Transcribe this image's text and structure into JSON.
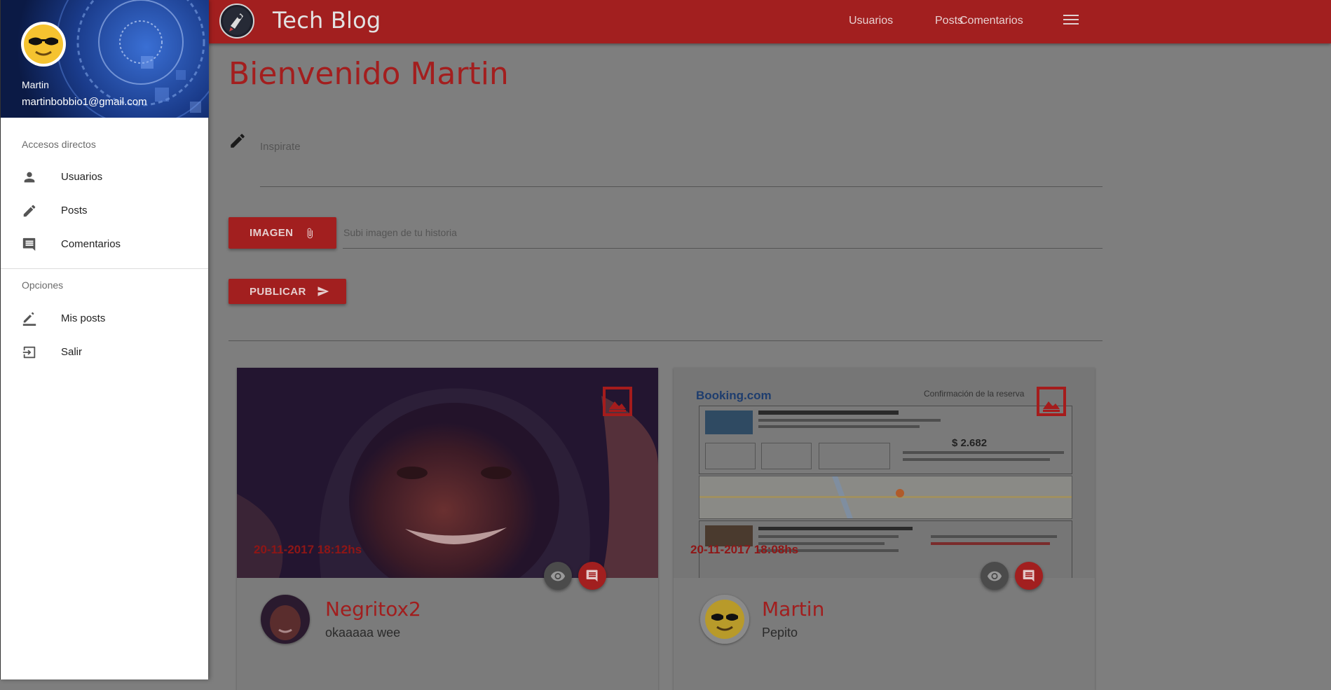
{
  "app": {
    "title": "Tech Blog"
  },
  "topnav": {
    "items": [
      "Usuarios",
      "Posts",
      "Comentarios"
    ],
    "menu_icon": "hamburger-menu-icon"
  },
  "drawer": {
    "user_name": "Martin",
    "user_email": "martinbobbio1@gmail.com",
    "sections": [
      {
        "title": "Accesos directos",
        "items": [
          {
            "label": "Usuarios",
            "icon": "person-icon"
          },
          {
            "label": "Posts",
            "icon": "pencil-icon"
          },
          {
            "label": "Comentarios",
            "icon": "comment-icon"
          }
        ]
      },
      {
        "title": "Opciones",
        "items": [
          {
            "label": "Mis posts",
            "icon": "edit-underline-icon"
          },
          {
            "label": "Salir",
            "icon": "exit-icon"
          }
        ]
      }
    ]
  },
  "main": {
    "welcome": "Bienvenido Martin",
    "story_placeholder": "Inspirate",
    "image_button": "IMAGEN",
    "image_placeholder": "Subi imagen de tu historia",
    "publish_button": "PUBLICAR"
  },
  "posts": [
    {
      "date": "20-11-2017 18:12hs",
      "author": "Negritox2",
      "text": "okaaaaa wee"
    },
    {
      "date": "20-11-2017 18:08hs",
      "author": "Martin",
      "text": "Pepito",
      "image_brand": "Booking.com",
      "image_heading": "Confirmación de la reserva",
      "image_price": "$ 2.682"
    }
  ],
  "colors": {
    "primary": "#a21f1f",
    "drawer_bg": "#ffffff",
    "backdrop": "#7e7e7e"
  }
}
